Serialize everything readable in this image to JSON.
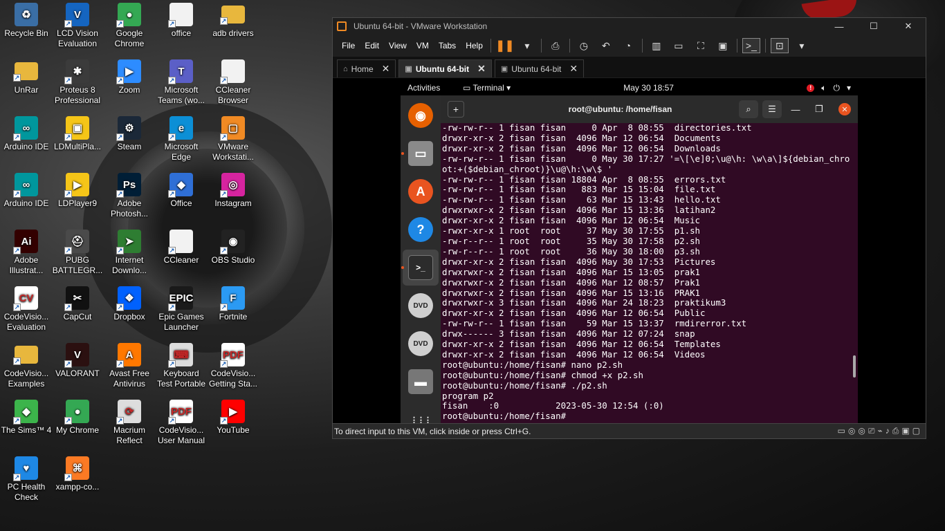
{
  "desktop": {
    "icons": [
      {
        "label": "Recycle Bin",
        "icon": "recycle-bin-icon",
        "color": "#3a6ea5",
        "glyph": "♻"
      },
      {
        "label": "LCD Vision Evaluation",
        "icon": "lcd-vision-icon",
        "color": "#1565c0",
        "glyph": "V"
      },
      {
        "label": "Google Chrome",
        "icon": "chrome-icon",
        "color": "#34a853",
        "glyph": "●"
      },
      {
        "label": "office",
        "icon": "file-icon",
        "color": "#f2f2f2",
        "glyph": ""
      },
      {
        "label": "adb drivers",
        "icon": "folder-icon",
        "color": "#e8b73d",
        "glyph": ""
      },
      {
        "label": "UnRar",
        "icon": "folder-icon",
        "color": "#e8b73d",
        "glyph": ""
      },
      {
        "label": "Proteus 8 Professional",
        "icon": "proteus-icon",
        "color": "#3b3b3b",
        "glyph": "✱"
      },
      {
        "label": "Zoom",
        "icon": "zoom-icon",
        "color": "#2d8cff",
        "glyph": "▶"
      },
      {
        "label": "Microsoft Teams (wo...",
        "icon": "teams-icon",
        "color": "#5b5fc7",
        "glyph": "T"
      },
      {
        "label": "CCleaner Browser",
        "icon": "file-icon",
        "color": "#f2f2f2",
        "glyph": ""
      },
      {
        "label": "Arduino IDE",
        "icon": "arduino-icon",
        "color": "#00979d",
        "glyph": "∞"
      },
      {
        "label": "LDMultiPla...",
        "icon": "ldmultiplayer-icon",
        "color": "#f5c518",
        "glyph": "▣"
      },
      {
        "label": "Steam",
        "icon": "steam-icon",
        "color": "#1b2838",
        "glyph": "⚙"
      },
      {
        "label": "Microsoft Edge",
        "icon": "edge-icon",
        "color": "#0c8fd6",
        "glyph": "e"
      },
      {
        "label": "VMware Workstati...",
        "icon": "vmware-icon",
        "color": "#f08a24",
        "glyph": "▢"
      },
      {
        "label": "Arduino IDE",
        "icon": "arduino-icon",
        "color": "#00979d",
        "glyph": "∞"
      },
      {
        "label": "LDPlayer9",
        "icon": "ldplayer-icon",
        "color": "#f5c518",
        "glyph": "▶"
      },
      {
        "label": "Adobe Photosh...",
        "icon": "photoshop-icon",
        "color": "#001e36",
        "glyph": "Ps"
      },
      {
        "label": "Office",
        "icon": "office-icon",
        "color": "#2f6fd6",
        "glyph": "◆"
      },
      {
        "label": "Instagram",
        "icon": "instagram-icon",
        "color": "#d6249f",
        "glyph": "◎"
      },
      {
        "label": "Adobe Illustrat...",
        "icon": "illustrator-icon",
        "color": "#330000",
        "glyph": "Ai"
      },
      {
        "label": "PUBG BATTLEGR...",
        "icon": "pubg-icon",
        "color": "#4a4a4a",
        "glyph": "⛑"
      },
      {
        "label": "Internet Downlo...",
        "icon": "idm-icon",
        "color": "#2e7d32",
        "glyph": "➤"
      },
      {
        "label": "CCleaner",
        "icon": "file-icon",
        "color": "#f2f2f2",
        "glyph": ""
      },
      {
        "label": "OBS Studio",
        "icon": "obs-icon",
        "color": "#222222",
        "glyph": "◉"
      },
      {
        "label": "CodeVisio... Evaluation",
        "icon": "codevision-icon",
        "color": "#ffffff",
        "glyph": "CV"
      },
      {
        "label": "CapCut",
        "icon": "capcut-icon",
        "color": "#111111",
        "glyph": "✂"
      },
      {
        "label": "Dropbox",
        "icon": "dropbox-icon",
        "color": "#0061fe",
        "glyph": "❖"
      },
      {
        "label": "Epic Games Launcher",
        "icon": "epic-games-icon",
        "color": "#1a1a1a",
        "glyph": "EPIC"
      },
      {
        "label": "Fortnite",
        "icon": "fortnite-icon",
        "color": "#2b9af3",
        "glyph": "F"
      },
      {
        "label": "CodeVisio... Examples",
        "icon": "folder-icon",
        "color": "#e8b73d",
        "glyph": ""
      },
      {
        "label": "VALORANT",
        "icon": "valorant-icon",
        "color": "#2b1010",
        "glyph": "V"
      },
      {
        "label": "Avast Free Antivirus",
        "icon": "avast-icon",
        "color": "#ff7800",
        "glyph": "A"
      },
      {
        "label": "Keyboard Test Portable",
        "icon": "keyboard-icon",
        "color": "#dddddd",
        "glyph": "⌨"
      },
      {
        "label": "CodeVisio... Getting Sta...",
        "icon": "pdf-icon",
        "color": "#ffffff",
        "glyph": "PDF"
      },
      {
        "label": "The Sims™ 4",
        "icon": "sims-icon",
        "color": "#3cb44b",
        "glyph": "◆"
      },
      {
        "label": "My Chrome",
        "icon": "chrome-icon",
        "color": "#34a853",
        "glyph": "●"
      },
      {
        "label": "Macrium Reflect",
        "icon": "macrium-icon",
        "color": "#dddddd",
        "glyph": "⟳"
      },
      {
        "label": "CodeVisio... User Manual",
        "icon": "pdf-icon",
        "color": "#ffffff",
        "glyph": "PDF"
      },
      {
        "label": "YouTube",
        "icon": "youtube-icon",
        "color": "#ff0000",
        "glyph": "▶"
      },
      {
        "label": "PC Health Check",
        "icon": "pc-health-icon",
        "color": "#1e88e5",
        "glyph": "♥"
      },
      {
        "label": "xampp-co...",
        "icon": "xampp-icon",
        "color": "#fb7a24",
        "glyph": "⌘"
      }
    ]
  },
  "vmware": {
    "title": "Ubuntu 64-bit - VMware Workstation",
    "window_controls": {
      "minimize": "—",
      "maximize": "☐",
      "close": "✕"
    },
    "menu": [
      "File",
      "Edit",
      "View",
      "VM",
      "Tabs",
      "Help"
    ],
    "tabs": [
      {
        "label": "Home",
        "icon": "home-icon"
      },
      {
        "label": "Ubuntu 64-bit",
        "icon": "vm-icon"
      },
      {
        "label": "Ubuntu 64-bit",
        "icon": "vm-icon"
      }
    ],
    "status_text": "To direct input to this VM, click inside or press Ctrl+G."
  },
  "ubuntu": {
    "activities": "Activities",
    "app_menu": "Terminal ▾",
    "clock": "May 30  18:57",
    "terminal_title": "root@ubuntu: /home/fisan",
    "terminal_lines": [
      "-rw-rw-r-- 1 fisan fisan     0 Apr  8 08:55  directories.txt",
      "drwxr-xr-x 2 fisan fisan  4096 Mar 12 06:54  Documents",
      "drwxr-xr-x 2 fisan fisan  4096 Mar 12 06:54  Downloads",
      "-rw-rw-r-- 1 fisan fisan     0 May 30 17:27 '=\\[\\e]0;\\u@\\h: \\w\\a\\]${debian_chro",
      "ot:+($debian_chroot)}\\u@\\h:\\w\\$ '",
      "-rw-rw-r-- 1 fisan fisan 18804 Apr  8 08:55  errors.txt",
      "-rw-rw-r-- 1 fisan fisan   883 Mar 15 15:04  file.txt",
      "-rw-rw-r-- 1 fisan fisan    63 Mar 15 13:43  hello.txt",
      "drwxrwxr-x 2 fisan fisan  4096 Mar 15 13:36  latihan2",
      "drwxr-xr-x 2 fisan fisan  4096 Mar 12 06:54  Music",
      "-rwxr-xr-x 1 root  root     37 May 30 17:55  p1.sh",
      "-rw-r--r-- 1 root  root     35 May 30 17:58  p2.sh",
      "-rw-r--r-- 1 root  root     36 May 30 18:00  p3.sh",
      "drwxr-xr-x 2 fisan fisan  4096 May 30 17:53  Pictures",
      "drwxrwxr-x 2 fisan fisan  4096 Mar 15 13:05  prak1",
      "drwxrwxr-x 2 fisan fisan  4096 Mar 12 08:57  Prak1",
      "drwxrwxr-x 2 fisan fisan  4096 Mar 15 13:16  PRAK1",
      "drwxrwxr-x 3 fisan fisan  4096 Mar 24 18:23  praktikum3",
      "drwxr-xr-x 2 fisan fisan  4096 Mar 12 06:54  Public",
      "-rw-rw-r-- 1 fisan fisan    59 Mar 15 13:37  rmdirerror.txt",
      "drwx------ 3 fisan fisan  4096 Mar 12 07:24  snap",
      "drwxr-xr-x 2 fisan fisan  4096 Mar 12 06:54  Templates",
      "drwxr-xr-x 2 fisan fisan  4096 Mar 12 06:54  Videos",
      "root@ubuntu:/home/fisan# nano p2.sh",
      "root@ubuntu:/home/fisan# chmod +x p2.sh",
      "root@ubuntu:/home/fisan# ./p2.sh",
      "program p2",
      "fisan    :0           2023-05-30 12:54 (:0)",
      "root@ubuntu:/home/fisan# "
    ],
    "dock": [
      {
        "name": "firefox",
        "color": "#e66000",
        "glyph": "◉"
      },
      {
        "name": "files",
        "color": "#8a8a8a",
        "glyph": "▭"
      },
      {
        "name": "app-center",
        "color": "#e95420",
        "glyph": "A"
      },
      {
        "name": "help",
        "color": "#1e88e5",
        "glyph": "?"
      },
      {
        "name": "terminal",
        "color": "#2c2c2c",
        "glyph": ">_"
      },
      {
        "name": "dvd-1",
        "color": "#cfcfcf",
        "glyph": "DVD"
      },
      {
        "name": "dvd-2",
        "color": "#cfcfcf",
        "glyph": "DVD"
      },
      {
        "name": "drive",
        "color": "#777777",
        "glyph": "▬"
      },
      {
        "name": "show-apps",
        "color": "#2c2c2c",
        "glyph": "⋮⋮⋮"
      }
    ]
  }
}
